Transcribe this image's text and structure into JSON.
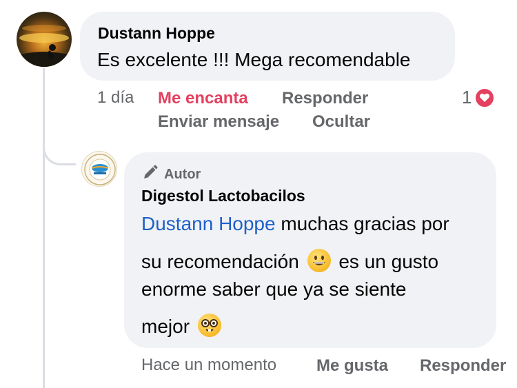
{
  "comment": {
    "author": "Dustann Hoppe",
    "text": "Es excelente !!! Mega recomendable",
    "time": "1 día",
    "reaction_label": "Me encanta",
    "reply_label": "Responder",
    "message_label": "Enviar mensaje",
    "hide_label": "Ocultar",
    "reaction_count": "1",
    "reaction_icon": "heart-icon",
    "reaction_color": "#e4405f"
  },
  "reply": {
    "badge": "Autor",
    "author": "Digestol Lactobacilos",
    "mention": "Dustann Hoppe",
    "line1": " muchas gracias por",
    "line2a": "su recomendación ",
    "line2b": " es un gusto",
    "line3": "enorme saber que ya se siente",
    "line4": "mejor ",
    "emoji1": "grinning-face-emoji",
    "emoji2": "nerd-face-emoji",
    "time": "Hace un momento",
    "like_label": "Me gusta",
    "reply_label": "Responder",
    "mention_color": "#1e60c8"
  }
}
